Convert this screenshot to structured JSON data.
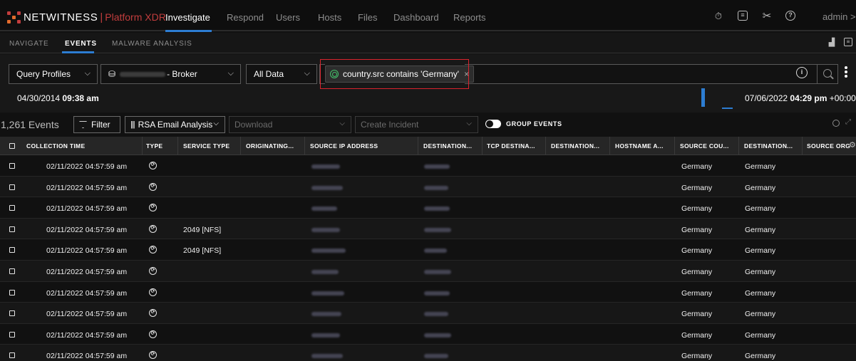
{
  "app": {
    "brand": "NETWITNESS",
    "separator": "|",
    "product": "Platform XDR",
    "brand_colors": {
      "accent": "#2d7dd2",
      "brand_red": "#c23d3d",
      "highlight": "#d9232d",
      "geo_green": "#44c26b"
    }
  },
  "topnav": {
    "items": [
      "Investigate",
      "Respond",
      "Users",
      "Hosts",
      "Files",
      "Dashboard",
      "Reports"
    ],
    "active": "Investigate",
    "icons": [
      "stopwatch-icon",
      "notes-icon",
      "tools-icon",
      "help-icon"
    ],
    "user": "admin",
    "user_chevron": ">"
  },
  "subnav": {
    "items": [
      "NAVIGATE",
      "EVENTS",
      "MALWARE ANALYSIS"
    ],
    "active": "EVENTS",
    "right_icons": [
      "chart-icon",
      "settings-panel-icon"
    ]
  },
  "query": {
    "profiles_label": "Query Profiles",
    "service_suffix": "- Broker",
    "data_scope": "All Data",
    "filter_pill": "country.src contains 'Germany'",
    "info_icon": "i",
    "time_start_date": "04/30/2014",
    "time_start_time": "09:38 am",
    "time_end_date": "07/06/2022",
    "time_end_time": "04:29 pm",
    "time_end_tz": "+00:00"
  },
  "events_toolbar": {
    "count": "1,261 Events",
    "filter_label": "Filter",
    "column_group": "RSA Email Analysis",
    "download_label": "Download",
    "create_incident_label": "Create Incident",
    "group_events_label": "GROUP EVENTS"
  },
  "table": {
    "columns": [
      "COLLECTION TIME",
      "TYPE",
      "SERVICE TYPE",
      "ORIGINATING...",
      "SOURCE IP ADDRESS",
      "DESTINATION...",
      "TCP DESTINA...",
      "DESTINATION...",
      "HOSTNAME A...",
      "SOURCE COU...",
      "DESTINATION...",
      "SOURCE ORG"
    ],
    "rows": [
      {
        "time": "02/11/2022 04:57:59 am",
        "service": "",
        "src_country": "Germany",
        "dst_country": "Germany"
      },
      {
        "time": "02/11/2022 04:57:59 am",
        "service": "",
        "src_country": "Germany",
        "dst_country": "Germany"
      },
      {
        "time": "02/11/2022 04:57:59 am",
        "service": "",
        "src_country": "Germany",
        "dst_country": "Germany"
      },
      {
        "time": "02/11/2022 04:57:59 am",
        "service": "2049 [NFS]",
        "src_country": "Germany",
        "dst_country": "Germany"
      },
      {
        "time": "02/11/2022 04:57:59 am",
        "service": "2049 [NFS]",
        "src_country": "Germany",
        "dst_country": "Germany"
      },
      {
        "time": "02/11/2022 04:57:59 am",
        "service": "",
        "src_country": "Germany",
        "dst_country": "Germany"
      },
      {
        "time": "02/11/2022 04:57:59 am",
        "service": "",
        "src_country": "Germany",
        "dst_country": "Germany"
      },
      {
        "time": "02/11/2022 04:57:59 am",
        "service": "",
        "src_country": "Germany",
        "dst_country": "Germany"
      },
      {
        "time": "02/11/2022 04:57:59 am",
        "service": "",
        "src_country": "Germany",
        "dst_country": "Germany"
      },
      {
        "time": "02/11/2022 04:57:59 am",
        "service": "",
        "src_country": "Germany",
        "dst_country": "Germany"
      }
    ]
  }
}
